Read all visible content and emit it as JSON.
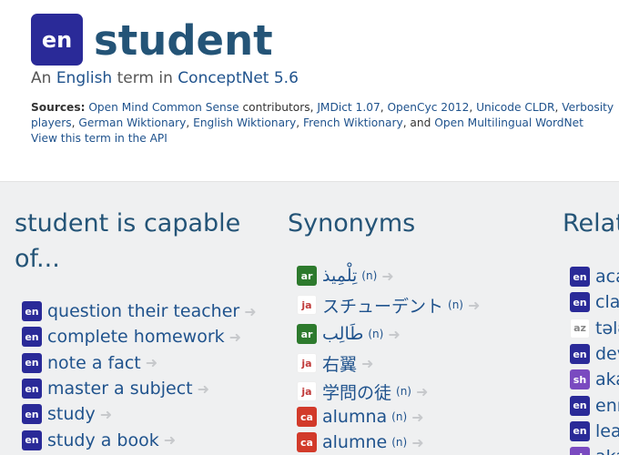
{
  "header": {
    "lang_code": "en",
    "term": "student",
    "subtitle_prefix": "An ",
    "subtitle_lang": "English",
    "subtitle_mid": " term in ",
    "subtitle_project": "ConceptNet 5.6"
  },
  "sources": {
    "label": "Sources:",
    "links": [
      "Open Mind Common Sense",
      "JMDict 1.07",
      "OpenCyc 2012",
      "Unicode CLDR",
      "Verbosity players",
      "German Wiktionary",
      "English Wiktionary",
      "French Wiktionary",
      "Open Multilingual WordNet"
    ],
    "contributors": " contributors, ",
    "separator": ", ",
    "and": ", and ",
    "api_link": "View this term in the API"
  },
  "columns": {
    "capable": {
      "title": "student is capable of...",
      "items": [
        {
          "lang": "en",
          "text": "question their teacher"
        },
        {
          "lang": "en",
          "text": "complete homework"
        },
        {
          "lang": "en",
          "text": "note a fact"
        },
        {
          "lang": "en",
          "text": "master a subject"
        },
        {
          "lang": "en",
          "text": "study"
        },
        {
          "lang": "en",
          "text": "study a book"
        }
      ]
    },
    "synonyms": {
      "title": "Synonyms",
      "items": [
        {
          "lang": "ar",
          "text": "تِلْمِيذ",
          "pos": "(n)"
        },
        {
          "lang": "ja",
          "text": "スチューデント",
          "pos": "(n)"
        },
        {
          "lang": "ar",
          "text": "طَالِب",
          "pos": "(n)"
        },
        {
          "lang": "ja",
          "text": "右翼",
          "pos": ""
        },
        {
          "lang": "ja",
          "text": "学問の徒",
          "pos": "(n)"
        },
        {
          "lang": "ca",
          "text": "alumna",
          "pos": "(n)"
        },
        {
          "lang": "ca",
          "text": "alumne",
          "pos": "(n)"
        }
      ]
    },
    "related": {
      "title": "Related terms",
      "items": [
        {
          "lang": "en",
          "text": "academic"
        },
        {
          "lang": "en",
          "text": "class"
        },
        {
          "lang": "az",
          "text": "tələbə"
        },
        {
          "lang": "en",
          "text": "dev"
        },
        {
          "lang": "sh",
          "text": "akademik"
        },
        {
          "lang": "en",
          "text": "enroll"
        },
        {
          "lang": "en",
          "text": "learn"
        },
        {
          "lang": "sh",
          "text": "aka"
        }
      ]
    }
  },
  "arrow_glyph": "➜",
  "colors": {
    "accent_blue": "#2a2a98",
    "link": "#20538d",
    "title": "#245477",
    "background_section": "#eff0f1"
  }
}
